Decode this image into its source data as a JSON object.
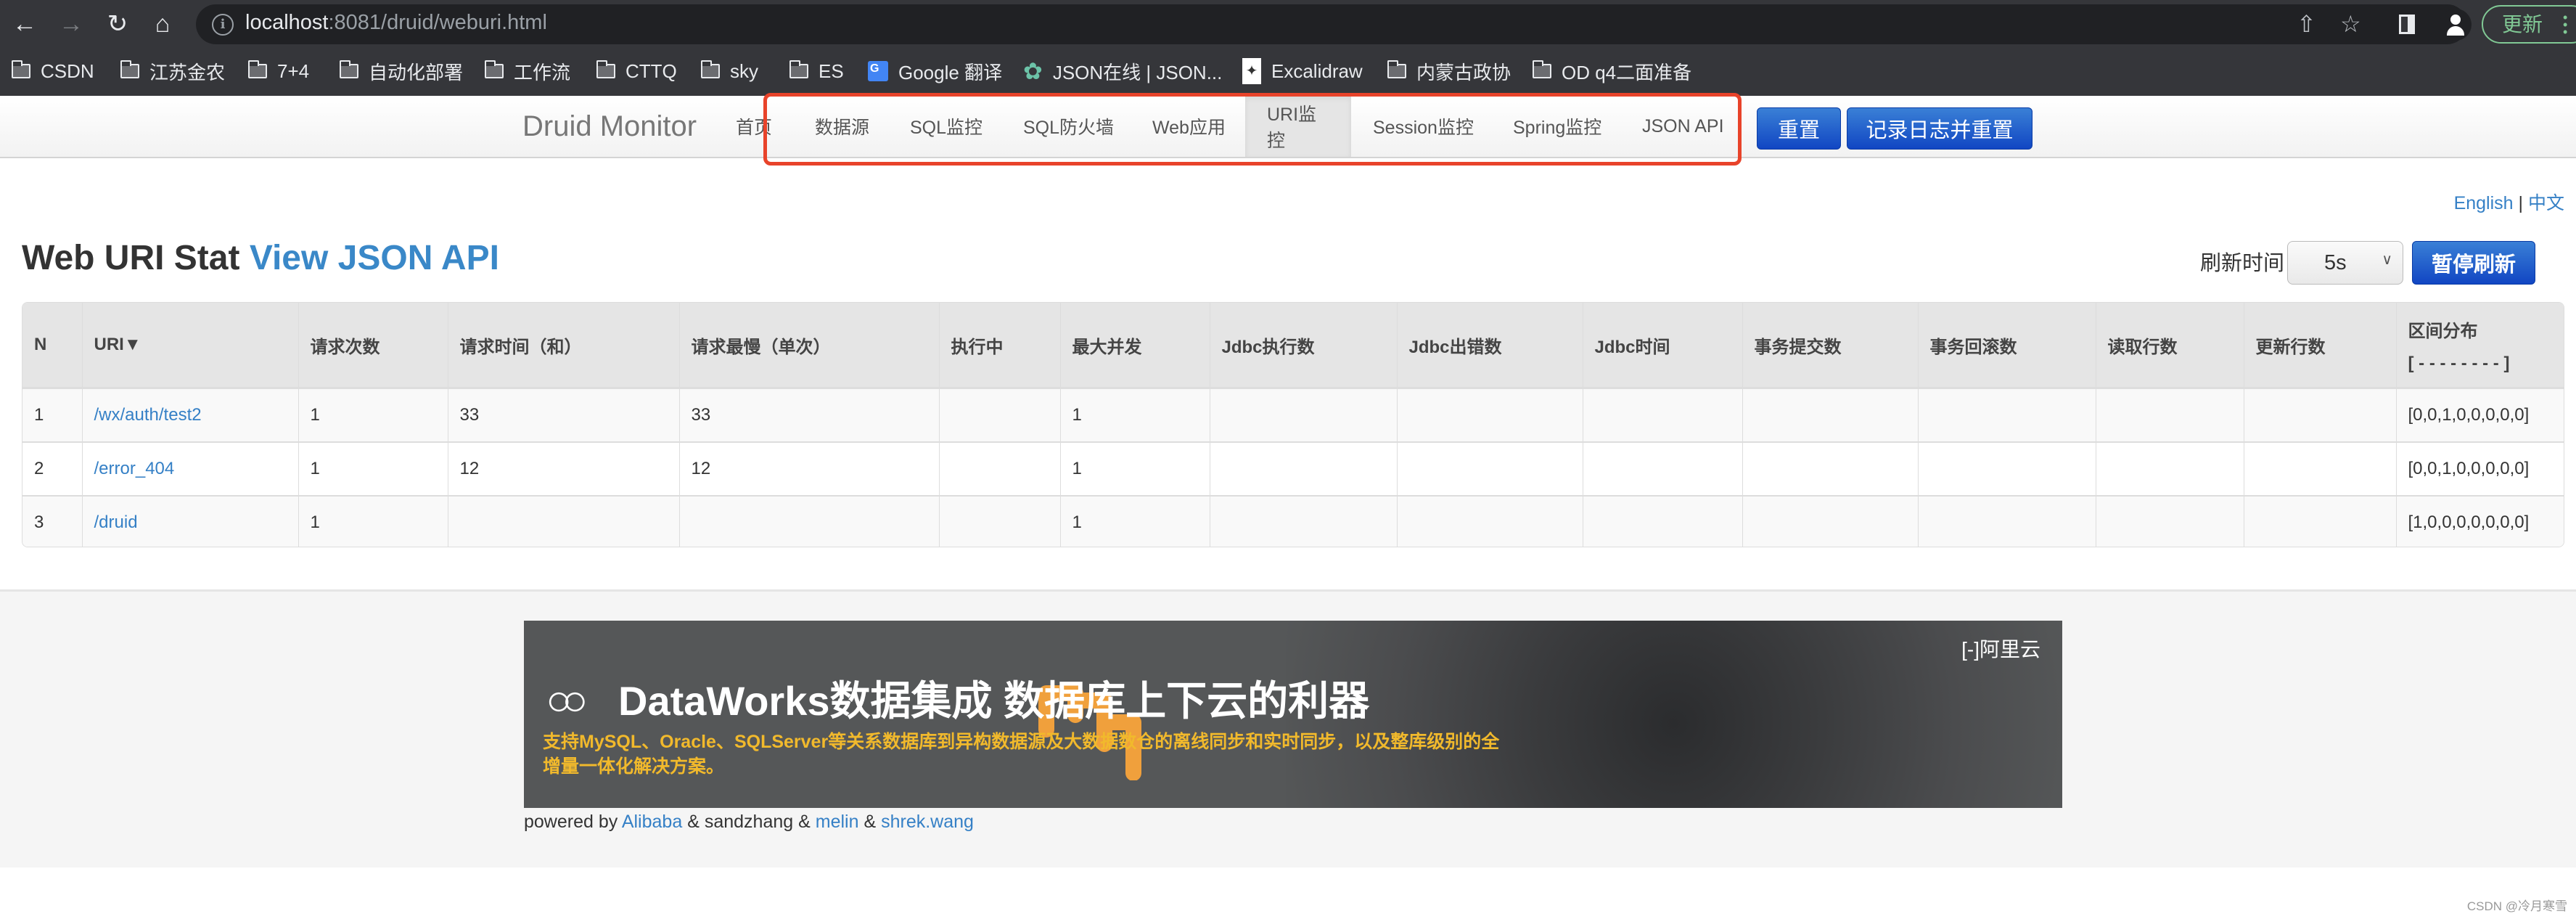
{
  "browser": {
    "url_host": "localhost",
    "url_rest": ":8081/druid/weburi.html",
    "update_label": "更新",
    "bookmarks": [
      {
        "label": "CSDN",
        "icon": "folder-icon"
      },
      {
        "label": "江苏金农",
        "icon": "folder-icon"
      },
      {
        "label": "7+4",
        "icon": "folder-icon"
      },
      {
        "label": "自动化部署",
        "icon": "folder-icon"
      },
      {
        "label": "工作流",
        "icon": "folder-icon"
      },
      {
        "label": "CTTQ",
        "icon": "folder-icon"
      },
      {
        "label": "sky",
        "icon": "folder-icon"
      },
      {
        "label": "ES",
        "icon": "folder-icon"
      },
      {
        "label": "Google 翻译",
        "icon": "google-translate-icon"
      },
      {
        "label": "JSON在线 | JSON...",
        "icon": "json-online-icon"
      },
      {
        "label": "Excalidraw",
        "icon": "excalidraw-icon"
      },
      {
        "label": "内蒙古政协",
        "icon": "folder-icon"
      },
      {
        "label": "OD q4二面准备",
        "icon": "folder-icon"
      }
    ]
  },
  "navbar": {
    "brand": "Druid Monitor",
    "items": [
      {
        "label": "首页",
        "active": false
      },
      {
        "label": "数据源",
        "active": false
      },
      {
        "label": "SQL监控",
        "active": false
      },
      {
        "label": "SQL防火墙",
        "active": false
      },
      {
        "label": "Web应用",
        "active": false
      },
      {
        "label": "URI监控",
        "active": true
      },
      {
        "label": "Session监控",
        "active": false
      },
      {
        "label": "Spring监控",
        "active": false
      },
      {
        "label": "JSON API",
        "active": false
      }
    ],
    "reset_label": "重置",
    "log_reset_label": "记录日志并重置"
  },
  "lang": {
    "english": "English",
    "separator": "|",
    "chinese": "中文"
  },
  "page": {
    "title": "Web URI Stat",
    "json_link": "View JSON API",
    "refresh_label": "刷新时间",
    "refresh_value": "5s",
    "pause_label": "暂停刷新"
  },
  "table": {
    "headers": [
      "N",
      "URI▼",
      "请求次数",
      "请求时间（和）",
      "请求最慢（单次）",
      "执行中",
      "最大并发",
      "Jdbc执行数",
      "Jdbc出错数",
      "Jdbc时间",
      "事务提交数",
      "事务回滚数",
      "读取行数",
      "更新行数",
      "区间分布"
    ],
    "histogram_header_line2": "[ - - - - - - - - ]",
    "rows": [
      [
        "1",
        "/wx/auth/test2",
        "1",
        "33",
        "33",
        "",
        "1",
        "",
        "",
        "",
        "",
        "",
        "",
        "",
        "[0,0,1,0,0,0,0,0]"
      ],
      [
        "2",
        "/error_404",
        "1",
        "12",
        "12",
        "",
        "1",
        "",
        "",
        "",
        "",
        "",
        "",
        "",
        "[0,0,1,0,0,0,0,0]"
      ],
      [
        "3",
        "/druid",
        "1",
        "",
        "",
        "",
        "1",
        "",
        "",
        "",
        "",
        "",
        "",
        "",
        "[1,0,0,0,0,0,0,0]"
      ]
    ]
  },
  "banner": {
    "title": "DataWorks数据集成 数据库上下云的利器",
    "subtitle": "支持MySQL、Oracle、SQLServer等关系数据库到异构数据源及大数据数仓的离线同步和实时同步，以及整库级别的全增量一体化解决方案。",
    "brand": "阿里云",
    "accent_color": "#f1b92c"
  },
  "footer": {
    "powered_by": "powered by",
    "alibaba": "Alibaba",
    "amp1": "&",
    "sandzhang": "sandzhang",
    "amp2": "&",
    "melin": "melin",
    "amp3": "&",
    "shrek": "shrek.wang"
  },
  "watermark": "CSDN @冷月寒雪"
}
